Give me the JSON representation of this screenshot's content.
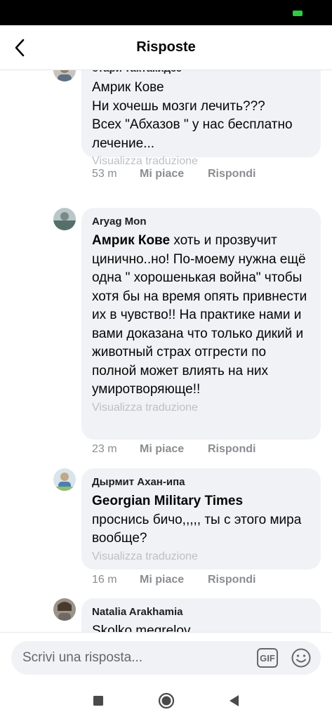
{
  "header": {
    "title": "Risposte",
    "back_icon": "chevron-left-icon"
  },
  "comments": [
    {
      "author": "отари тактакидзе",
      "mention": "",
      "text": "Амрик Кове\nНи хочешь мозги лечить???\nВсех \"Абхазов \" у нас бесплатно лечение...",
      "translate": "Visualizza traduzione",
      "time": "53 m",
      "like": "Mi piace",
      "reply": "Rispondi"
    },
    {
      "author": "Aryag Mon",
      "mention": "Амрик Кове",
      "text": " хоть и прозвучит цинично..но! По-моему нужна ещё одна \" хорошенькая война\" чтобы хотя бы на время опять привнести их в чувство!! На практике нами и вами доказана что только дикий и животный страх отгрести по полной  может влиять на них умиротворяюще!!",
      "translate": "Visualizza traduzione",
      "time": "23 m",
      "like": "Mi piace",
      "reply": "Rispondi"
    },
    {
      "author": "Дырмит Ахан-ипа",
      "mention": "Georgian Military Times",
      "text": "проснись бичо,,,,, ты с этого мира вообще?",
      "translate": "Visualizza traduzione",
      "time": "16 m",
      "like": "Mi piace",
      "reply": "Rispondi"
    },
    {
      "author": "Natalia Arakhamia",
      "mention": "",
      "text": "Skolko megrelov",
      "translate": "",
      "time": "",
      "like": "",
      "reply": ""
    }
  ],
  "composer": {
    "placeholder": "Scrivi una risposta...",
    "gif_label": "GIF",
    "emoji_icon": "smiley-icon"
  },
  "colors": {
    "bubble": "#f0f2f5",
    "muted": "#8a8d91",
    "translate": "#bcc0c4",
    "battery": "#2ecc40"
  }
}
